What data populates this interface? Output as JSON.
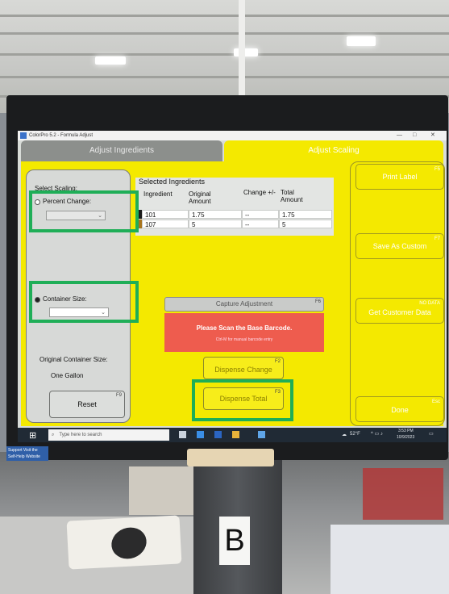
{
  "window": {
    "title": "ColorPro 5.2 - Formula Adjust",
    "controls": [
      "—",
      "□",
      "✕"
    ]
  },
  "tabs": {
    "adjust_ingredients": "Adjust Ingredients",
    "adjust_scaling": "Adjust Scaling"
  },
  "scaling": {
    "select_label": "Select Scaling:",
    "percent_change_label": "Percent Change:",
    "container_size_label": "Container Size:",
    "original_container_label": "Original Container Size:",
    "original_container_value": "One Gallon",
    "reset_label": "Reset",
    "reset_key": "F9"
  },
  "table": {
    "title": "Selected Ingredients",
    "columns": [
      "Ingredient",
      "Original Amount",
      "Change +/-",
      "Total Amount"
    ],
    "rows": [
      {
        "ingredient": "101",
        "original": "1.75",
        "change": "--",
        "total": "1.75",
        "color": "#1a1a1a"
      },
      {
        "ingredient": "107",
        "original": "5",
        "change": "--",
        "total": "5",
        "color": "#a8741e"
      }
    ]
  },
  "actions": {
    "capture_label": "Capture Adjustment",
    "capture_key": "F6",
    "scan_title": "Please Scan the Base Barcode.",
    "scan_subtitle": "Ctrl-M for manual barcode entry",
    "dispense_change": "Dispense Change",
    "dispense_change_key": "F2",
    "dispense_total": "Dispense Total",
    "dispense_total_key": "F3"
  },
  "right_buttons": {
    "print_label": "Print Label",
    "print_key": "F5",
    "save_custom": "Save As Custom",
    "save_key": "F7",
    "nodata": "NO DATA",
    "customer_data": "Get Customer Data",
    "done": "Done",
    "done_key": "Esc"
  },
  "taskbar": {
    "search_placeholder": "Type here to search",
    "weather": "52°F",
    "time": "3:53 PM",
    "date": "10/9/2023"
  },
  "sticker": {
    "text": "Support Visit the Self-Help Website"
  },
  "desk_note": {
    "letter": "B"
  },
  "colors": {
    "app_yellow": "#f4e900",
    "scan_red": "#ee5c4e",
    "highlight_green": "#1fae57"
  }
}
